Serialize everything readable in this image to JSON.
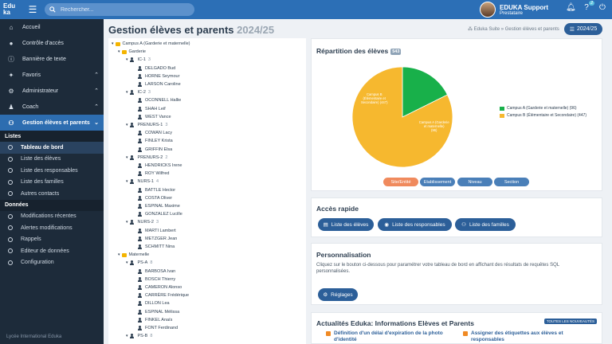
{
  "topbar": {
    "logo_line1": "Edu",
    "logo_line2": "ka",
    "search_placeholder": "Rechercher...",
    "user_name": "EDUKA Support",
    "user_role": "Prestataire",
    "help_badge": "2"
  },
  "sidebar": {
    "items": [
      {
        "label": "Accueil",
        "icon": "home-icon"
      },
      {
        "label": "Contrôle d'accès",
        "icon": "lock-icon"
      },
      {
        "label": "Bannière de texte",
        "icon": "info-icon"
      },
      {
        "label": "Favoris",
        "icon": "pin-icon"
      },
      {
        "label": "Administrateur",
        "icon": "user-gear-icon"
      },
      {
        "label": "Coach",
        "icon": "coach-icon"
      },
      {
        "label": "Gestion élèves et parents",
        "icon": "users-icon"
      }
    ],
    "section_listes": "Listes",
    "listes": [
      "Tableau de bord",
      "Liste des élèves",
      "Liste des responsables",
      "Liste des familles",
      "Autres contacts"
    ],
    "section_donnees": "Données",
    "donnees": [
      "Modifications récentes",
      "Alertes modifications",
      "Rappels",
      "Editeur de données",
      "Configuration"
    ],
    "footer": "Lycée International Eduka"
  },
  "header": {
    "title": "Gestion élèves et parents",
    "year": "2024/25",
    "breadcrumb": "Eduka Suite » Gestion élèves et parents",
    "year_button": "2024/25"
  },
  "tree": {
    "campus": "Campus A (Garderie et maternelle)",
    "garderie": "Garderie",
    "groups": [
      {
        "name": "IC-1",
        "count": "3",
        "people": [
          "DELGADO Bud",
          "HORNE Seymour",
          "LARSON Caroline"
        ]
      },
      {
        "name": "IC-2",
        "count": "3",
        "people": [
          "OCONNELL Hallie",
          "SHAH Leif",
          "WEST Vance"
        ]
      },
      {
        "name": "PRENURS-1",
        "count": "3",
        "people": [
          "COWAN Lacy",
          "FINLEY Krista",
          "GRIFFIN Elsa"
        ]
      },
      {
        "name": "PRENURS-2",
        "count": "2",
        "people": [
          "HENDRICKS Irene",
          "ROY Wilfred"
        ]
      },
      {
        "name": "NURS-1",
        "count": "4",
        "people": [
          "BATTLE Hector",
          "COSTA Oliver",
          "ESPINAL Maxime",
          "GONZALEZ Lucille"
        ]
      },
      {
        "name": "NURS-2",
        "count": "3",
        "people": [
          "MARTI Lambert",
          "METZGER Jean",
          "SCHMITT Nina"
        ]
      }
    ],
    "maternelle": "Maternelle",
    "mgroups": [
      {
        "name": "PS-A",
        "count": "8",
        "people": [
          "BARBOSA Ivan",
          "BOSCH Thierry",
          "CAMERON Alonso",
          "CARRÈRE Frédérique",
          "DILLON Lea",
          "ESPINAL Mélissa",
          "FINKEL Anaïs",
          "FONT Ferdinand"
        ]
      },
      {
        "name": "PS-B",
        "count": "8",
        "people": []
      }
    ]
  },
  "repartition": {
    "title": "Répartition des élèves",
    "total": "543",
    "buttons": [
      "Site/Entité",
      "Etablissement",
      "Niveau",
      "Section"
    ]
  },
  "chart_data": {
    "type": "pie",
    "categories": [
      "Campus A (Garderie et maternelle)",
      "Campus B (Élémentaire et Secondaire)"
    ],
    "values": [
      96,
      447
    ],
    "legend_labels": [
      "Campus A (Garderie et maternelle) (96)",
      "Campus B (Élémentaire et Secondaire) (447)"
    ],
    "slice_labels": [
      "Campus A (Garderie et maternelle) (96)",
      "Campus B (Élémentaire et Secondaire) (447)"
    ],
    "colors": [
      "#18b04a",
      "#f6b82f"
    ],
    "legend": "right"
  },
  "acces": {
    "title": "Accès rapide",
    "buttons": [
      "Liste des élèves",
      "Liste des responsables",
      "Liste des familles"
    ]
  },
  "perso": {
    "title": "Personnalisation",
    "text": "Cliquez sur le bouton ci-dessous pour paramétrer votre tableau de bord en affichant des résultats de requêtes SQL personnalisées.",
    "button": "Réglages"
  },
  "actualites": {
    "title": "Actualités Eduka: Informations Elèves et Parents",
    "all_button": "TOUTES LES NOUVEAUTÉS",
    "items": [
      "Définition d'un délai d'expiration de la photo d'identité",
      "Assigner des étiquettes aux élèves et responsables"
    ]
  }
}
